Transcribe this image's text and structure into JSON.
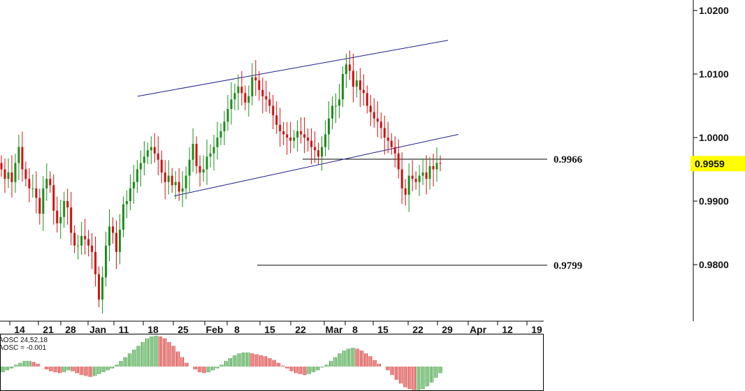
{
  "chart_data": {
    "type": "candlestick",
    "price_axis": {
      "ticks": [
        "1.0200",
        "1.0100",
        "1.0000",
        "0.9900",
        "0.9800"
      ],
      "range": [
        0.971,
        1.022
      ]
    },
    "date_axis": {
      "labels": [
        "14",
        "21",
        "28",
        "Jan",
        "11",
        "18",
        "25",
        "Feb",
        "8",
        "15",
        "22",
        "Mar",
        "8",
        "15",
        "22",
        "29",
        "Apr",
        "12",
        "19"
      ]
    },
    "current_price": {
      "label": "0.9959",
      "value": 0.9959,
      "color": "#ffff00"
    },
    "levels": [
      {
        "label": "0.9966",
        "value": 0.9966
      },
      {
        "label": "0.9799",
        "value": 0.9799
      }
    ],
    "channel": {
      "upper": [
        [
          30,
          1.0065
        ],
        [
          89,
          1.0153
        ]
      ],
      "lower": [
        [
          36,
          0.9908
        ],
        [
          94,
          1.0005
        ]
      ]
    },
    "candles_close": [
      0.995,
      0.9935,
      0.9945,
      0.993,
      0.996,
      0.9985,
      0.995,
      0.9935,
      0.992,
      0.992,
      0.9905,
      0.988,
      0.992,
      0.9935,
      0.9925,
      0.9885,
      0.9865,
      0.9875,
      0.99,
      0.989,
      0.985,
      0.983,
      0.983,
      0.9845,
      0.984,
      0.983,
      0.982,
      0.9785,
      0.9745,
      0.978,
      0.983,
      0.986,
      0.985,
      0.982,
      0.9855,
      0.9895,
      0.99,
      0.992,
      0.993,
      0.995,
      0.996,
      0.997,
      0.998,
      0.9985,
      0.9975,
      0.9965,
      0.9945,
      0.993,
      0.994,
      0.9925,
      0.993,
      0.9915,
      0.992,
      0.994,
      0.9965,
      0.999,
      0.9955,
      0.9945,
      0.995,
      0.997,
      0.9975,
      0.9985,
      1.0,
      1.001,
      1.0025,
      1.0045,
      1.006,
      1.007,
      1.008,
      1.007,
      1.0055,
      1.0065,
      1.0095,
      1.009,
      1.0075,
      1.0065,
      1.006,
      1.005,
      1.0035,
      1.002,
      1.001,
      1.0005,
      1.0,
      0.9995,
      1.0,
      1.001,
      1.0005,
      1.0,
      0.9995,
      0.9985,
      0.998,
      0.997,
      0.9985,
      1.0005,
      1.003,
      1.005,
      1.005,
      1.006,
      1.01,
      1.0115,
      1.0105,
      1.008,
      1.009,
      1.0075,
      1.007,
      1.005,
      1.004,
      1.003,
      1.0025,
      1.0015,
      1.0,
      0.9995,
      0.9985,
      0.9975,
      0.995,
      0.992,
      0.991,
      0.994,
      0.9935,
      0.993,
      0.994,
      0.9945,
      0.9935,
      0.9955,
      0.995,
      0.996,
      0.9959
    ],
    "oscillator": {
      "label": "AOSC 24,52,18",
      "value_label": "AOSC = -0.001",
      "up_color": "#1a8f1a",
      "down_color": "#d01010",
      "values": [
        -0.3,
        -0.2,
        -0.1,
        0.1,
        0.2,
        0.3,
        0.3,
        0.25,
        0.15,
        0.0,
        -0.15,
        -0.25,
        -0.3,
        -0.35,
        -0.3,
        -0.2,
        -0.25,
        -0.35,
        -0.45,
        -0.5,
        -0.55,
        -0.5,
        -0.4,
        -0.3,
        -0.2,
        -0.1,
        0.1,
        0.3,
        0.5,
        0.7,
        0.9,
        1.1,
        1.3,
        1.5,
        1.6,
        1.65,
        1.6,
        1.5,
        1.3,
        1.1,
        0.8,
        0.5,
        0.2,
        0.0,
        -0.15,
        -0.3,
        -0.35,
        -0.3,
        -0.2,
        -0.1,
        0.1,
        0.3,
        0.45,
        0.6,
        0.7,
        0.75,
        0.75,
        0.7,
        0.65,
        0.6,
        0.55,
        0.45,
        0.35,
        0.2,
        0.05,
        -0.1,
        -0.25,
        -0.35,
        -0.4,
        -0.45,
        -0.4,
        -0.3,
        -0.2,
        -0.05,
        0.1,
        0.3,
        0.5,
        0.7,
        0.85,
        0.95,
        1.0,
        0.95,
        0.85,
        0.7,
        0.55,
        0.35,
        0.15,
        0.0,
        -0.2,
        -0.45,
        -0.7,
        -0.9,
        -1.1,
        -1.2,
        -1.25,
        -1.25,
        -1.2,
        -1.05,
        -0.85,
        -0.6,
        -0.35
      ]
    },
    "colors": {
      "up": "#1a8f1a",
      "down": "#d01010",
      "channel": "#1a1a8c",
      "level": "#000000"
    }
  }
}
